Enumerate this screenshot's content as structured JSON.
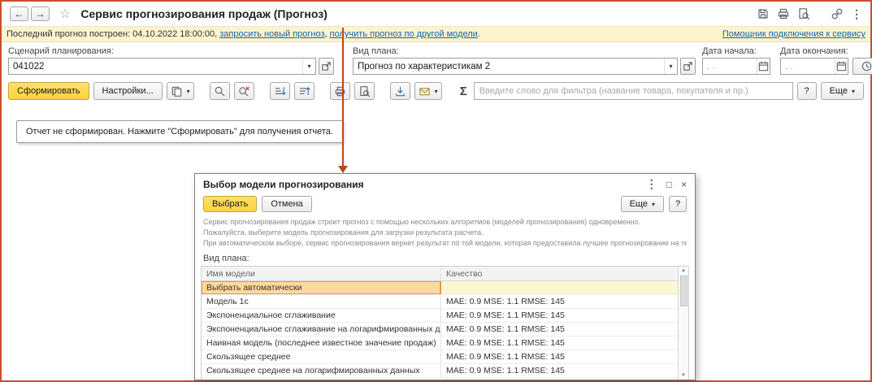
{
  "window": {
    "title": "Сервис прогнозирования продаж (Прогноз)"
  },
  "glyphs": {
    "back": "←",
    "forward": "→",
    "star": "☆",
    "kebab": "⋮",
    "dropdown": "▾",
    "sigma": "Σ",
    "question": "?",
    "close": "×",
    "maximize": "□",
    "scroll_up": "▲",
    "scroll_down": "▼"
  },
  "notification": {
    "prefix": "Последний прогноз построен: 04.10.2022 18:00:00, ",
    "link_new": "запросить новый прогноз",
    "separator": ", ",
    "link_other": "получить прогноз по другой модели",
    "suffix": ".",
    "assistant_link": "Помощник подключения к сервису"
  },
  "fields": {
    "scenario": {
      "label": "Сценарий планирования:",
      "value": "041022"
    },
    "plan": {
      "label": "Вид плана:",
      "value": "Прогноз по характеристикам 2"
    },
    "date_start": {
      "label": "Дата начала:",
      "value": ". ."
    },
    "date_end": {
      "label": "Дата окончания:",
      "value": ". ."
    }
  },
  "toolbar": {
    "generate": "Сформировать",
    "settings": "Настройки...",
    "sigma": "Σ",
    "filter_placeholder": "Введите слово для фильтра (название товара, покупателя и пр.)",
    "help": "?",
    "more": "Еще"
  },
  "report": {
    "message": "Отчет не сформирован. Нажмите \"Сформировать\" для получения отчета."
  },
  "dialog": {
    "title": "Выбор модели прогнозирования",
    "buttons": {
      "select": "Выбрать",
      "cancel": "Отмена",
      "more": "Еще",
      "help": "?"
    },
    "description": [
      "Сервис прогнозирования продаж строит прогноз с помощью нескольких алгоритмов (моделей прогнозирования) одновременно.",
      "Пожалуйста, выберите модель прогнозирования для загрузки результата расчета.",
      "При автоматическом выборе, сервис прогнозирования вернет результат по той модели, которая предоставила лучшее прогнозирование на тестовом периоде."
    ],
    "plan_label": "Вид плана:",
    "table": {
      "headers": {
        "name": "Имя модели",
        "quality": "Качество"
      },
      "rows": [
        {
          "name": "Выбрать автоматически",
          "quality": ""
        },
        {
          "name": "Модель 1с",
          "quality": "MAE: 0.9 MSE: 1.1 RMSE: 145"
        },
        {
          "name": "Экспоненциальное сглаживание",
          "quality": "MAE: 0.9 MSE: 1.1 RMSE: 145"
        },
        {
          "name": "Экспоненциальное сглаживание на логарифмированных данных",
          "quality": "MAE: 0.9 MSE: 1.1 RMSE: 145"
        },
        {
          "name": "Наивная модель (последнее известное значение продаж)",
          "quality": "MAE: 0.9 MSE: 1.1 RMSE: 145"
        },
        {
          "name": "Скользящее среднее",
          "quality": "MAE: 0.9 MSE: 1.1 RMSE: 145"
        },
        {
          "name": "Скользящее среднее на логарифмированных данных",
          "quality": "MAE: 0.9 MSE: 1.1 RMSE: 145"
        }
      ]
    }
  },
  "colors": {
    "accent_yellow": "#ffd23e",
    "link_blue": "#0f66ad",
    "notification_bg": "#fdf3cf",
    "arrow_red": "#c0441a",
    "selected_cell": "#fbd9a1",
    "selected_row": "#fcf6d2"
  }
}
